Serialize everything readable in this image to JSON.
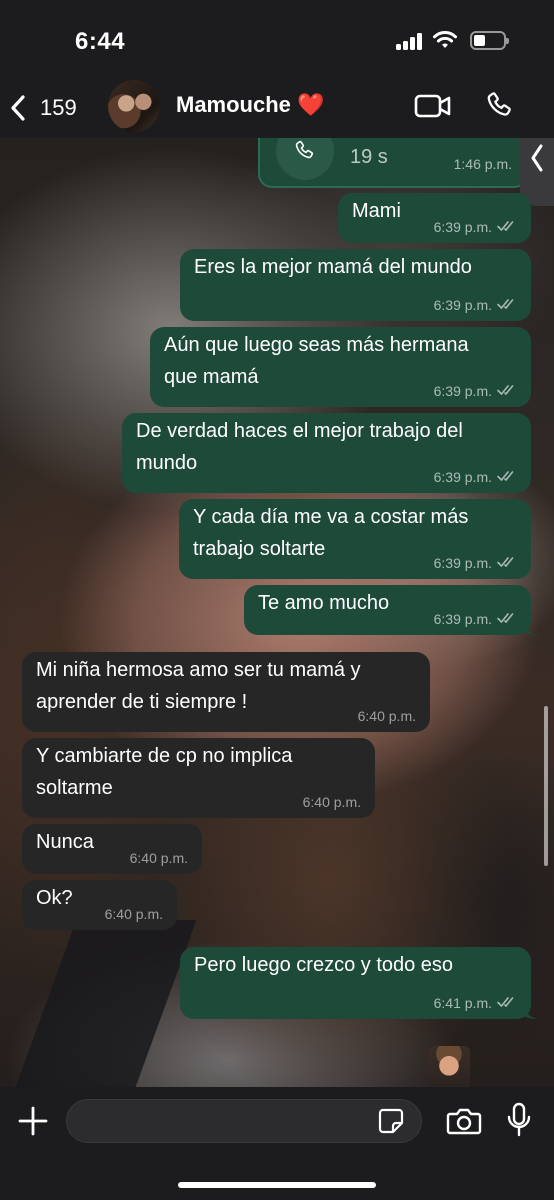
{
  "status_bar": {
    "time": "6:44"
  },
  "header": {
    "back_count": "159",
    "contact_name": "Mamouche ❤️"
  },
  "call": {
    "duration": "19 s",
    "time": "1:46 p.m."
  },
  "messages": [
    {
      "dir": "out",
      "text": "Mami",
      "time": "6:39 p.m."
    },
    {
      "dir": "out",
      "text": "Eres la mejor mamá del mundo",
      "time": "6:39 p.m."
    },
    {
      "dir": "out",
      "text": "Aún que luego seas más hermana\nque mamá",
      "time": "6:39 p.m."
    },
    {
      "dir": "out",
      "text": "De verdad haces el mejor trabajo del\nmundo",
      "time": "6:39 p.m."
    },
    {
      "dir": "out",
      "text": "Y cada día me va a costar más\ntrabajo soltarte",
      "time": "6:39 p.m."
    },
    {
      "dir": "out",
      "text": "Te amo mucho",
      "time": "6:39 p.m."
    },
    {
      "dir": "in",
      "text": "Mi niña hermosa amo ser tu mamá y\naprender de ti siempre !",
      "time": "6:40 p.m."
    },
    {
      "dir": "in",
      "text": "Y cambiarte de cp no implica\nsoltarme",
      "time": "6:40 p.m."
    },
    {
      "dir": "in",
      "text": "Nunca",
      "time": "6:40 p.m."
    },
    {
      "dir": "in",
      "text": "Ok?",
      "time": "6:40 p.m."
    },
    {
      "dir": "out",
      "text": "Pero luego crezco y todo eso",
      "time": "6:41 p.m."
    }
  ],
  "input": {
    "placeholder": ""
  },
  "colors": {
    "outgoing": "#1e4a3a",
    "incoming": "#262627",
    "header": "#1c1c1e"
  },
  "icons": [
    "back-chevron-icon",
    "video-call-icon",
    "phone-icon",
    "plus-icon",
    "sticker-icon",
    "camera-icon",
    "microphone-icon",
    "double-check-icon"
  ]
}
